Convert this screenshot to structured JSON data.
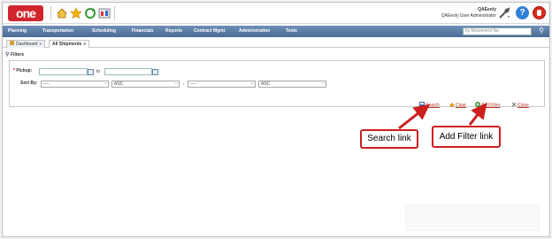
{
  "header": {
    "logo_text": "one",
    "user_name": "QAEenly",
    "user_role": "QAEenly User Administrator",
    "help_label": "?"
  },
  "menu": {
    "items": [
      "Planning",
      "Transportation",
      "Scheduling",
      "Financials",
      "Reports",
      "Contract Mgmt",
      "Administration",
      "Tools"
    ],
    "search_placeholder": "by Movement No"
  },
  "tabs": [
    {
      "label": "Dashboard",
      "close": "x"
    },
    {
      "label": "All Shipments",
      "close": "x"
    }
  ],
  "filters": {
    "title": "Filters",
    "pickup_label": "Pickup:",
    "required_mark": "*",
    "to_label": "to",
    "sortby_label": "Sort By:",
    "sort1_value": "----",
    "order1_value": "ASC",
    "comma": ",",
    "sort2_value": "----",
    "order2_value": "ASC"
  },
  "actions": {
    "search": "Search",
    "clear": "Clear",
    "add_filter": "Add Filter",
    "close": "Close"
  },
  "annotations": {
    "search_link": "Search link",
    "add_filter_link": "Add Filter link"
  },
  "colors": {
    "brand_red": "#d1262d",
    "menu_blue": "#4a6b94",
    "annotation_red": "#cc1f1f"
  }
}
